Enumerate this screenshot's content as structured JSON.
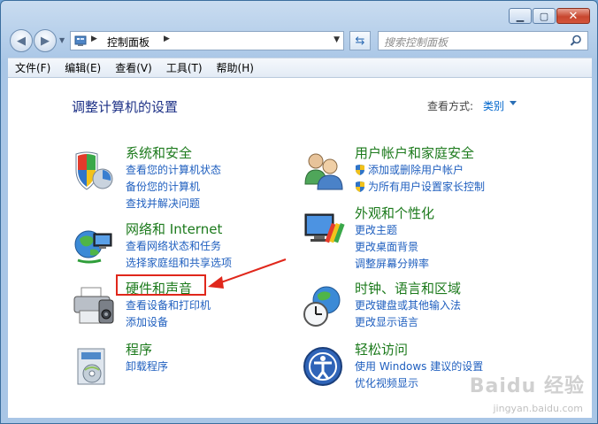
{
  "address": {
    "path": "控制面板"
  },
  "search": {
    "placeholder": "搜索控制面板"
  },
  "menu": [
    "文件(F)",
    "编辑(E)",
    "查看(V)",
    "工具(T)",
    "帮助(H)"
  ],
  "page": {
    "title": "调整计算机的设置",
    "view_label": "查看方式:",
    "view_value": "类别"
  },
  "categories": [
    {
      "heading": "系统和安全",
      "links": [
        "查看您的计算机状态",
        "备份您的计算机",
        "查找并解决问题"
      ]
    },
    {
      "heading": "网络和 Internet",
      "links": [
        "查看网络状态和任务",
        "选择家庭组和共享选项"
      ]
    },
    {
      "heading": "硬件和声音",
      "links": [
        "查看设备和打印机",
        "添加设备"
      ]
    },
    {
      "heading": "程序",
      "links": [
        "卸载程序"
      ]
    },
    {
      "heading": "用户帐户和家庭安全",
      "links": [
        "添加或删除用户帐户",
        "为所有用户设置家长控制"
      ]
    },
    {
      "heading": "外观和个性化",
      "links": [
        "更改主题",
        "更改桌面背景",
        "调整屏幕分辨率"
      ]
    },
    {
      "heading": "时钟、语言和区域",
      "links": [
        "更改键盘或其他输入法",
        "更改显示语言"
      ]
    },
    {
      "heading": "轻松访问",
      "links": [
        "使用 Windows 建议的设置",
        "优化视频显示"
      ]
    }
  ],
  "colors": {
    "heading": "#1c7a1c",
    "link": "#1f5fbf",
    "title": "#1e3287",
    "annotation": "#e0271b"
  },
  "watermark": {
    "brand": "Baidu 经验",
    "url": "jingyan.baidu.com"
  }
}
